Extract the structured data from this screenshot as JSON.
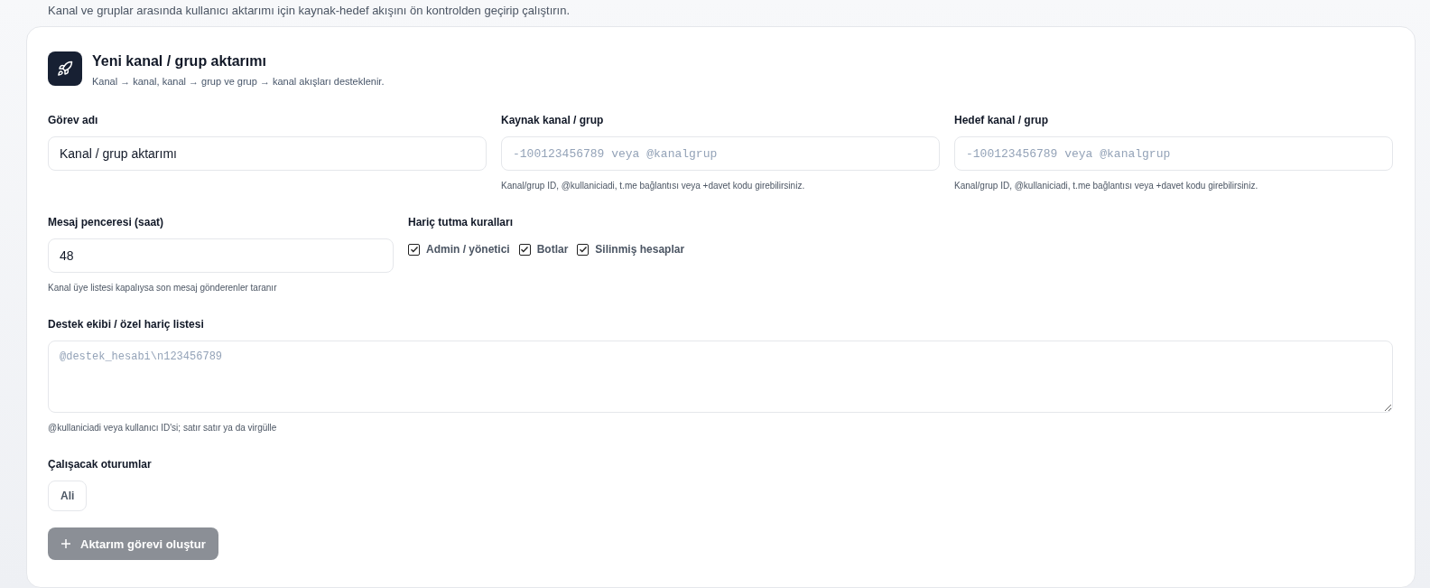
{
  "page": {
    "description": "Kanal ve gruplar arasında kullanıcı aktarımı için kaynak-hedef akışını ön kontrolden geçirip çalıştırın."
  },
  "card": {
    "title": "Yeni kanal / grup aktarımı",
    "subtitle": "Kanal → kanal, kanal → grup ve grup → kanal akışları desteklenir."
  },
  "fields_row": [
    {
      "label": "Görev adı",
      "value": "Kanal / grup aktarımı"
    },
    {
      "label": "Kaynak kanal / grup",
      "placeholder": "-100123456789 veya @kanalgrup",
      "hint": "Kanal/grup ID, @kullaniciadi, t.me bağlantısı veya +davet kodu girebilirsiniz."
    },
    {
      "label": "Hedef kanal / grup",
      "placeholder": "-100123456789 veya @kanalgrup",
      "hint": "Kanal/grup ID, @kullaniciadi, t.me bağlantısı veya +davet kodu girebilirsiniz."
    }
  ],
  "window_field": {
    "label": "Mesaj penceresi (saat)",
    "value": "48",
    "hint": "Kanal üye listesi kapalıysa son mesaj gönderenler taranır"
  },
  "exclusions": {
    "label": "Hariç tutma kuralları",
    "options": [
      {
        "label": "Admin / yönetici",
        "checked": true
      },
      {
        "label": "Botlar",
        "checked": true
      },
      {
        "label": "Silinmiş hesaplar",
        "checked": true
      }
    ]
  },
  "exclude_list": {
    "label": "Destek ekibi / özel hariç listesi",
    "placeholder": "@destek_hesabi\\n123456789",
    "hint": "@kullaniciadi veya kullanıcı ID'si; satır satır ya da virgülle"
  },
  "sessions": {
    "label": "Çalışacak oturumlar",
    "items": [
      {
        "label": "Ali",
        "selected": false
      }
    ]
  },
  "submit": {
    "label": "Aktarım görevi oluştur",
    "disabled": true
  }
}
